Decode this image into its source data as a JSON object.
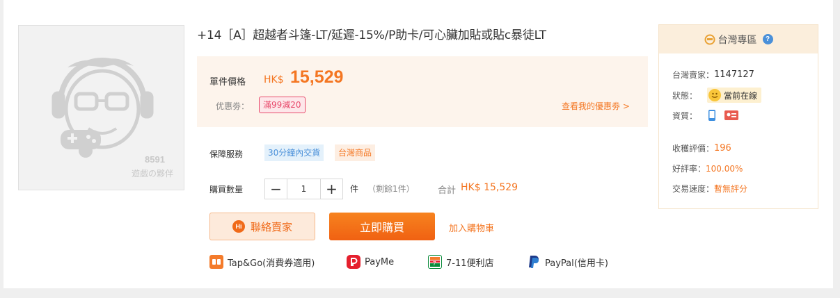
{
  "product": {
    "title": "+14［A］超越者斗篷-LT/延遲-15%/P助卡/可心臟加貼或貼c暴徒LT",
    "image_watermark_line1": "8591",
    "image_watermark_line2": "遊戲の夥伴"
  },
  "price": {
    "label": "單件價格",
    "currency": "HK$",
    "amount": "15,529",
    "coupon_label": "优惠劵：",
    "coupon_tag": "滿99減20",
    "my_coupons_link": "查看我的優惠劵 >"
  },
  "guarantee": {
    "label": "保障服務",
    "tags": [
      "30分鐘內交貨",
      "台灣商品"
    ]
  },
  "quantity": {
    "label": "購買數量",
    "value": "1",
    "minus": "−",
    "plus": "+",
    "unit": "件",
    "remaining": "（剩餘1件）",
    "total_label": "合計",
    "total_value": "HK$ 15,529"
  },
  "actions": {
    "contact_icon_text": "Hi",
    "contact_label": "聯絡賣家",
    "buy_label": "立即購買",
    "cart_label": "加入購物車"
  },
  "payments": [
    {
      "icon": "tapgo-icon",
      "label": "Tap&Go(消費券適用)",
      "color": "#f47b2b"
    },
    {
      "icon": "payme-icon",
      "label": "PayMe",
      "color": "#e5202e"
    },
    {
      "icon": "seven-eleven-icon",
      "label": "7-11便利店",
      "color": "#0a8a3a"
    },
    {
      "icon": "paypal-icon",
      "label": "PayPal(信用卡)",
      "color": "#1e3a8a"
    }
  ],
  "seller": {
    "header": "台灣專區",
    "help_icon_text": "?",
    "seller_label": "台灣賣家：",
    "seller_id": "1147127",
    "status_label": "狀態：",
    "status_value": "當前在線",
    "verify_label": "資質：",
    "rating_label": "收穫評價：",
    "rating_value": "196",
    "good_rate_label": "好評率：",
    "good_rate_value": "100.00%",
    "speed_label": "交易速度：",
    "speed_value": "暫無評分"
  },
  "colors": {
    "accent": "#f47622",
    "price_bg": "#fdf4ec",
    "coupon": "#e8486a",
    "blue": "#4a90d9"
  }
}
